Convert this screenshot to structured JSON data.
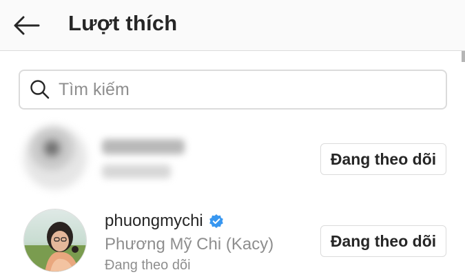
{
  "header": {
    "back_icon": "arrow-left-icon",
    "title": "Lượt thích"
  },
  "search": {
    "icon": "search-icon",
    "placeholder": "Tìm kiếm"
  },
  "likes": [
    {
      "username": "",
      "full_name": "",
      "status": "",
      "blurred": true,
      "button_label": "Đang theo dõi"
    },
    {
      "username": "phuongmychi",
      "verified": true,
      "verified_icon": "verified-badge-icon",
      "full_name": "Phương Mỹ Chi (Kacy)",
      "status": "Đang theo dõi",
      "button_label": "Đang theo dõi"
    }
  ],
  "colors": {
    "text_primary": "#262626",
    "text_secondary": "#8e8e8e",
    "border": "#dbdbdb",
    "verified_blue": "#3897f0",
    "header_bg": "#fafafa"
  }
}
